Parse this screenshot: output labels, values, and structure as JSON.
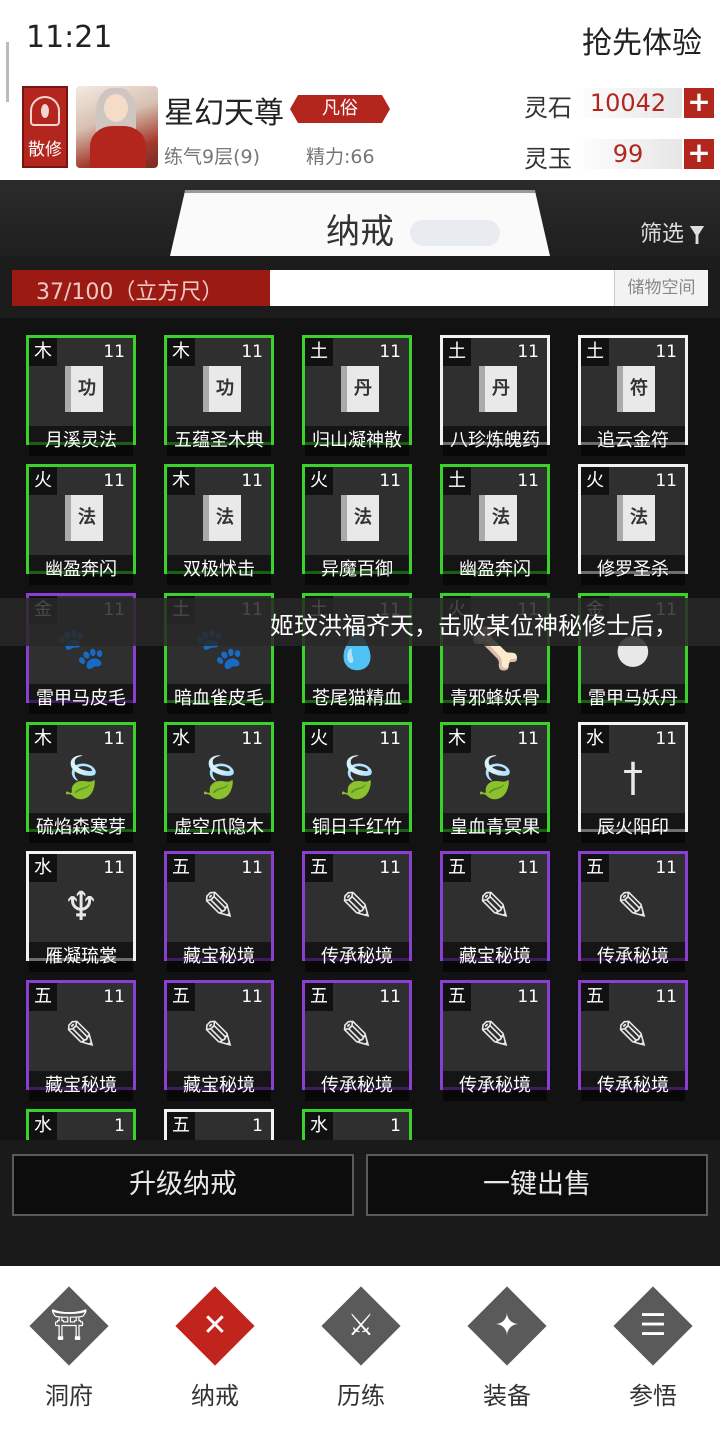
{
  "status": {
    "time": "11:21",
    "trial": "抢先体验"
  },
  "profile": {
    "badge": "散修",
    "name": "星幻天尊",
    "rank": "凡俗",
    "level": "练气9层(9)",
    "energy": "精力:66",
    "stone_label": "灵石",
    "stone_value": "10042",
    "jade_label": "灵玉",
    "jade_value": "99",
    "plus": "+"
  },
  "panel": {
    "title": "纳戒",
    "filter": "筛选",
    "capacity_text": "37/100（立方尺）",
    "capacity_fraction": 0.37,
    "storage_label": "储物空间",
    "marquee": "姬玟洪福齐天，击败某位神秘修士后，"
  },
  "items": [
    {
      "el": "木",
      "count": "11",
      "name": "月溪灵法",
      "border": "green",
      "icon": "功"
    },
    {
      "el": "木",
      "count": "11",
      "name": "五蕴圣木典",
      "border": "green",
      "icon": "功"
    },
    {
      "el": "土",
      "count": "11",
      "name": "归山凝神散",
      "border": "green",
      "icon": "丹"
    },
    {
      "el": "土",
      "count": "11",
      "name": "八珍炼魄药",
      "border": "white",
      "icon": "丹"
    },
    {
      "el": "土",
      "count": "11",
      "name": "追云金符",
      "border": "white",
      "icon": "符"
    },
    {
      "el": "火",
      "count": "11",
      "name": "幽盈奔闪",
      "border": "green",
      "icon": "法"
    },
    {
      "el": "木",
      "count": "11",
      "name": "双极怵击",
      "border": "green",
      "icon": "法"
    },
    {
      "el": "火",
      "count": "11",
      "name": "异魔百御",
      "border": "green",
      "icon": "法"
    },
    {
      "el": "土",
      "count": "11",
      "name": "幽盈奔闪",
      "border": "green",
      "icon": "法"
    },
    {
      "el": "火",
      "count": "11",
      "name": "修罗圣杀",
      "border": "white",
      "icon": "法"
    },
    {
      "el": "金",
      "count": "11",
      "name": "雷甲马皮毛",
      "border": "purple",
      "icon": "fur-icon"
    },
    {
      "el": "土",
      "count": "11",
      "name": "暗血雀皮毛",
      "border": "green",
      "icon": "fur-icon"
    },
    {
      "el": "土",
      "count": "11",
      "name": "苍尾猫精血",
      "border": "green",
      "icon": "blood-icon"
    },
    {
      "el": "火",
      "count": "11",
      "name": "青邪蜂妖骨",
      "border": "green",
      "icon": "bone-icon"
    },
    {
      "el": "金",
      "count": "11",
      "name": "雷甲马妖丹",
      "border": "green",
      "icon": "orb-icon"
    },
    {
      "el": "木",
      "count": "11",
      "name": "硫焰森寒芽",
      "border": "green",
      "icon": "leaf-icon"
    },
    {
      "el": "水",
      "count": "11",
      "name": "虚空爪隐木",
      "border": "green",
      "icon": "leaf-icon"
    },
    {
      "el": "火",
      "count": "11",
      "name": "铜日千红竹",
      "border": "green",
      "icon": "leaf-icon"
    },
    {
      "el": "木",
      "count": "11",
      "name": "皇血青冥果",
      "border": "green",
      "icon": "leaf-icon"
    },
    {
      "el": "水",
      "count": "11",
      "name": "辰火阳印",
      "border": "white",
      "icon": "sword-icon"
    },
    {
      "el": "水",
      "count": "11",
      "name": "雁凝琉裳",
      "border": "white",
      "icon": "robe-icon"
    },
    {
      "el": "五",
      "count": "11",
      "name": "藏宝秘境",
      "border": "purple",
      "icon": "map-icon"
    },
    {
      "el": "五",
      "count": "11",
      "name": "传承秘境",
      "border": "purple",
      "icon": "map-icon"
    },
    {
      "el": "五",
      "count": "11",
      "name": "藏宝秘境",
      "border": "purple",
      "icon": "map-icon"
    },
    {
      "el": "五",
      "count": "11",
      "name": "传承秘境",
      "border": "purple",
      "icon": "map-icon"
    },
    {
      "el": "五",
      "count": "11",
      "name": "藏宝秘境",
      "border": "purple",
      "icon": "map-icon"
    },
    {
      "el": "五",
      "count": "11",
      "name": "藏宝秘境",
      "border": "purple",
      "icon": "map-icon"
    },
    {
      "el": "五",
      "count": "11",
      "name": "传承秘境",
      "border": "purple",
      "icon": "map-icon"
    },
    {
      "el": "五",
      "count": "11",
      "name": "传承秘境",
      "border": "purple",
      "icon": "map-icon"
    },
    {
      "el": "五",
      "count": "11",
      "name": "传承秘境",
      "border": "purple",
      "icon": "map-icon"
    },
    {
      "el": "水",
      "count": "1",
      "name": "",
      "border": "green",
      "icon": "item-icon"
    },
    {
      "el": "五",
      "count": "1",
      "name": "",
      "border": "white",
      "icon": "item-icon"
    },
    {
      "el": "水",
      "count": "1",
      "name": "",
      "border": "green",
      "icon": "item-icon"
    }
  ],
  "actions": {
    "upgrade": "升级纳戒",
    "sell_all": "一键出售"
  },
  "nav": [
    {
      "label": "洞府",
      "icon": "gate-icon",
      "active": false
    },
    {
      "label": "纳戒",
      "icon": "ring-icon",
      "active": true
    },
    {
      "label": "历练",
      "icon": "swords-icon",
      "active": false
    },
    {
      "label": "装备",
      "icon": "dagger-icon",
      "active": false
    },
    {
      "label": "参悟",
      "icon": "book-icon",
      "active": false
    }
  ]
}
